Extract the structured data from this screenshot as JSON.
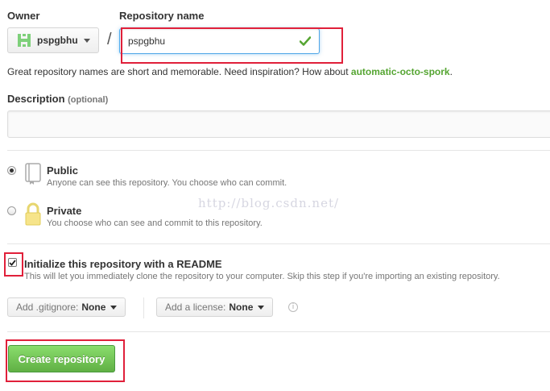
{
  "owner": {
    "label": "Owner",
    "name": "pspgbhu",
    "avatar_icon": "identicon"
  },
  "separator": "/",
  "repository": {
    "label": "Repository name",
    "value": "pspgbhu",
    "valid_icon": "check-icon"
  },
  "hint": {
    "text": "Great repository names are short and memorable. Need inspiration? How about ",
    "suggestion": "automatic-octo-spork",
    "end": "."
  },
  "description": {
    "label": "Description",
    "optional": "(optional)",
    "value": ""
  },
  "visibility": {
    "public": {
      "title": "Public",
      "desc": "Anyone can see this repository. You choose who can commit.",
      "selected": true
    },
    "private": {
      "title": "Private",
      "desc": "You choose who can see and commit to this repository.",
      "selected": false
    }
  },
  "watermark": "http://blog.csdn.net/",
  "readme": {
    "title": "Initialize this repository with a README",
    "desc": "This will let you immediately clone the repository to your computer. Skip this step if you're importing an existing repository.",
    "checked": true
  },
  "gitignore": {
    "prefix": "Add .gitignore:",
    "value": "None"
  },
  "license": {
    "prefix": "Add a license:",
    "value": "None"
  },
  "create_button": "Create repository",
  "colors": {
    "accent_green": "#55a532",
    "button_green": "#60b044",
    "highlight_red": "#e0203a"
  }
}
